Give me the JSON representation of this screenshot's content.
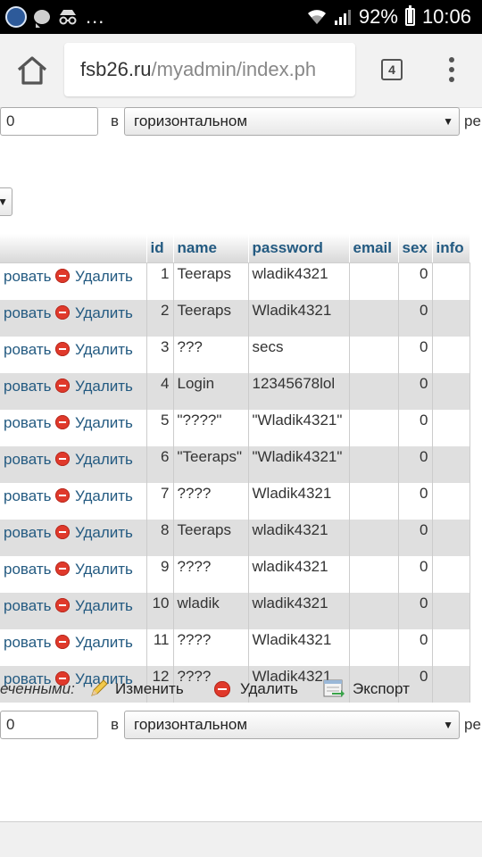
{
  "status_bar": {
    "battery": "92%",
    "time": "10:06",
    "more": "..."
  },
  "browser": {
    "url_host": "fsb26.ru",
    "url_path": "/myadmin/index.ph",
    "tab_count": "4"
  },
  "pager_top": {
    "start_value": "0",
    "in_label": "в",
    "mode": "горизонтальном",
    "trailing": "ре"
  },
  "pager_bottom": {
    "start_value": "0",
    "in_label": "в",
    "mode": "горизонтальном",
    "trailing": "ре"
  },
  "table": {
    "columns": [
      "id",
      "name",
      "password",
      "email",
      "sex",
      "info"
    ],
    "edit_label": "ровать",
    "delete_label": "Удалить",
    "rows": [
      {
        "id": "1",
        "name": "Teeraps",
        "password": "wladik4321",
        "email": "",
        "sex": "0",
        "info": ""
      },
      {
        "id": "2",
        "name": "Teeraps",
        "password": "Wladik4321",
        "email": "",
        "sex": "0",
        "info": ""
      },
      {
        "id": "3",
        "name": "???",
        "password": "secs",
        "email": "",
        "sex": "0",
        "info": ""
      },
      {
        "id": "4",
        "name": "Login",
        "password": "12345678lol",
        "email": "",
        "sex": "0",
        "info": ""
      },
      {
        "id": "5",
        "name": "\"????\"",
        "password": "\"Wladik4321\"",
        "email": "",
        "sex": "0",
        "info": ""
      },
      {
        "id": "6",
        "name": "\"Teeraps\"",
        "password": "\"Wladik4321\"",
        "email": "",
        "sex": "0",
        "info": ""
      },
      {
        "id": "7",
        "name": "????",
        "password": "Wladik4321",
        "email": "",
        "sex": "0",
        "info": ""
      },
      {
        "id": "8",
        "name": "Teeraps",
        "password": "wladik4321",
        "email": "",
        "sex": "0",
        "info": ""
      },
      {
        "id": "9",
        "name": "????",
        "password": "wladik4321",
        "email": "",
        "sex": "0",
        "info": ""
      },
      {
        "id": "10",
        "name": "wladik",
        "password": "wladik4321",
        "email": "",
        "sex": "0",
        "info": ""
      },
      {
        "id": "11",
        "name": "????",
        "password": "Wladik4321",
        "email": "",
        "sex": "0",
        "info": ""
      },
      {
        "id": "12",
        "name": "????",
        "password": "Wladik4321",
        "email": "",
        "sex": "0",
        "info": ""
      }
    ]
  },
  "with_selected": {
    "label": "еченными:",
    "edit": "Изменить",
    "delete": "Удалить",
    "export": "Экспорт"
  }
}
